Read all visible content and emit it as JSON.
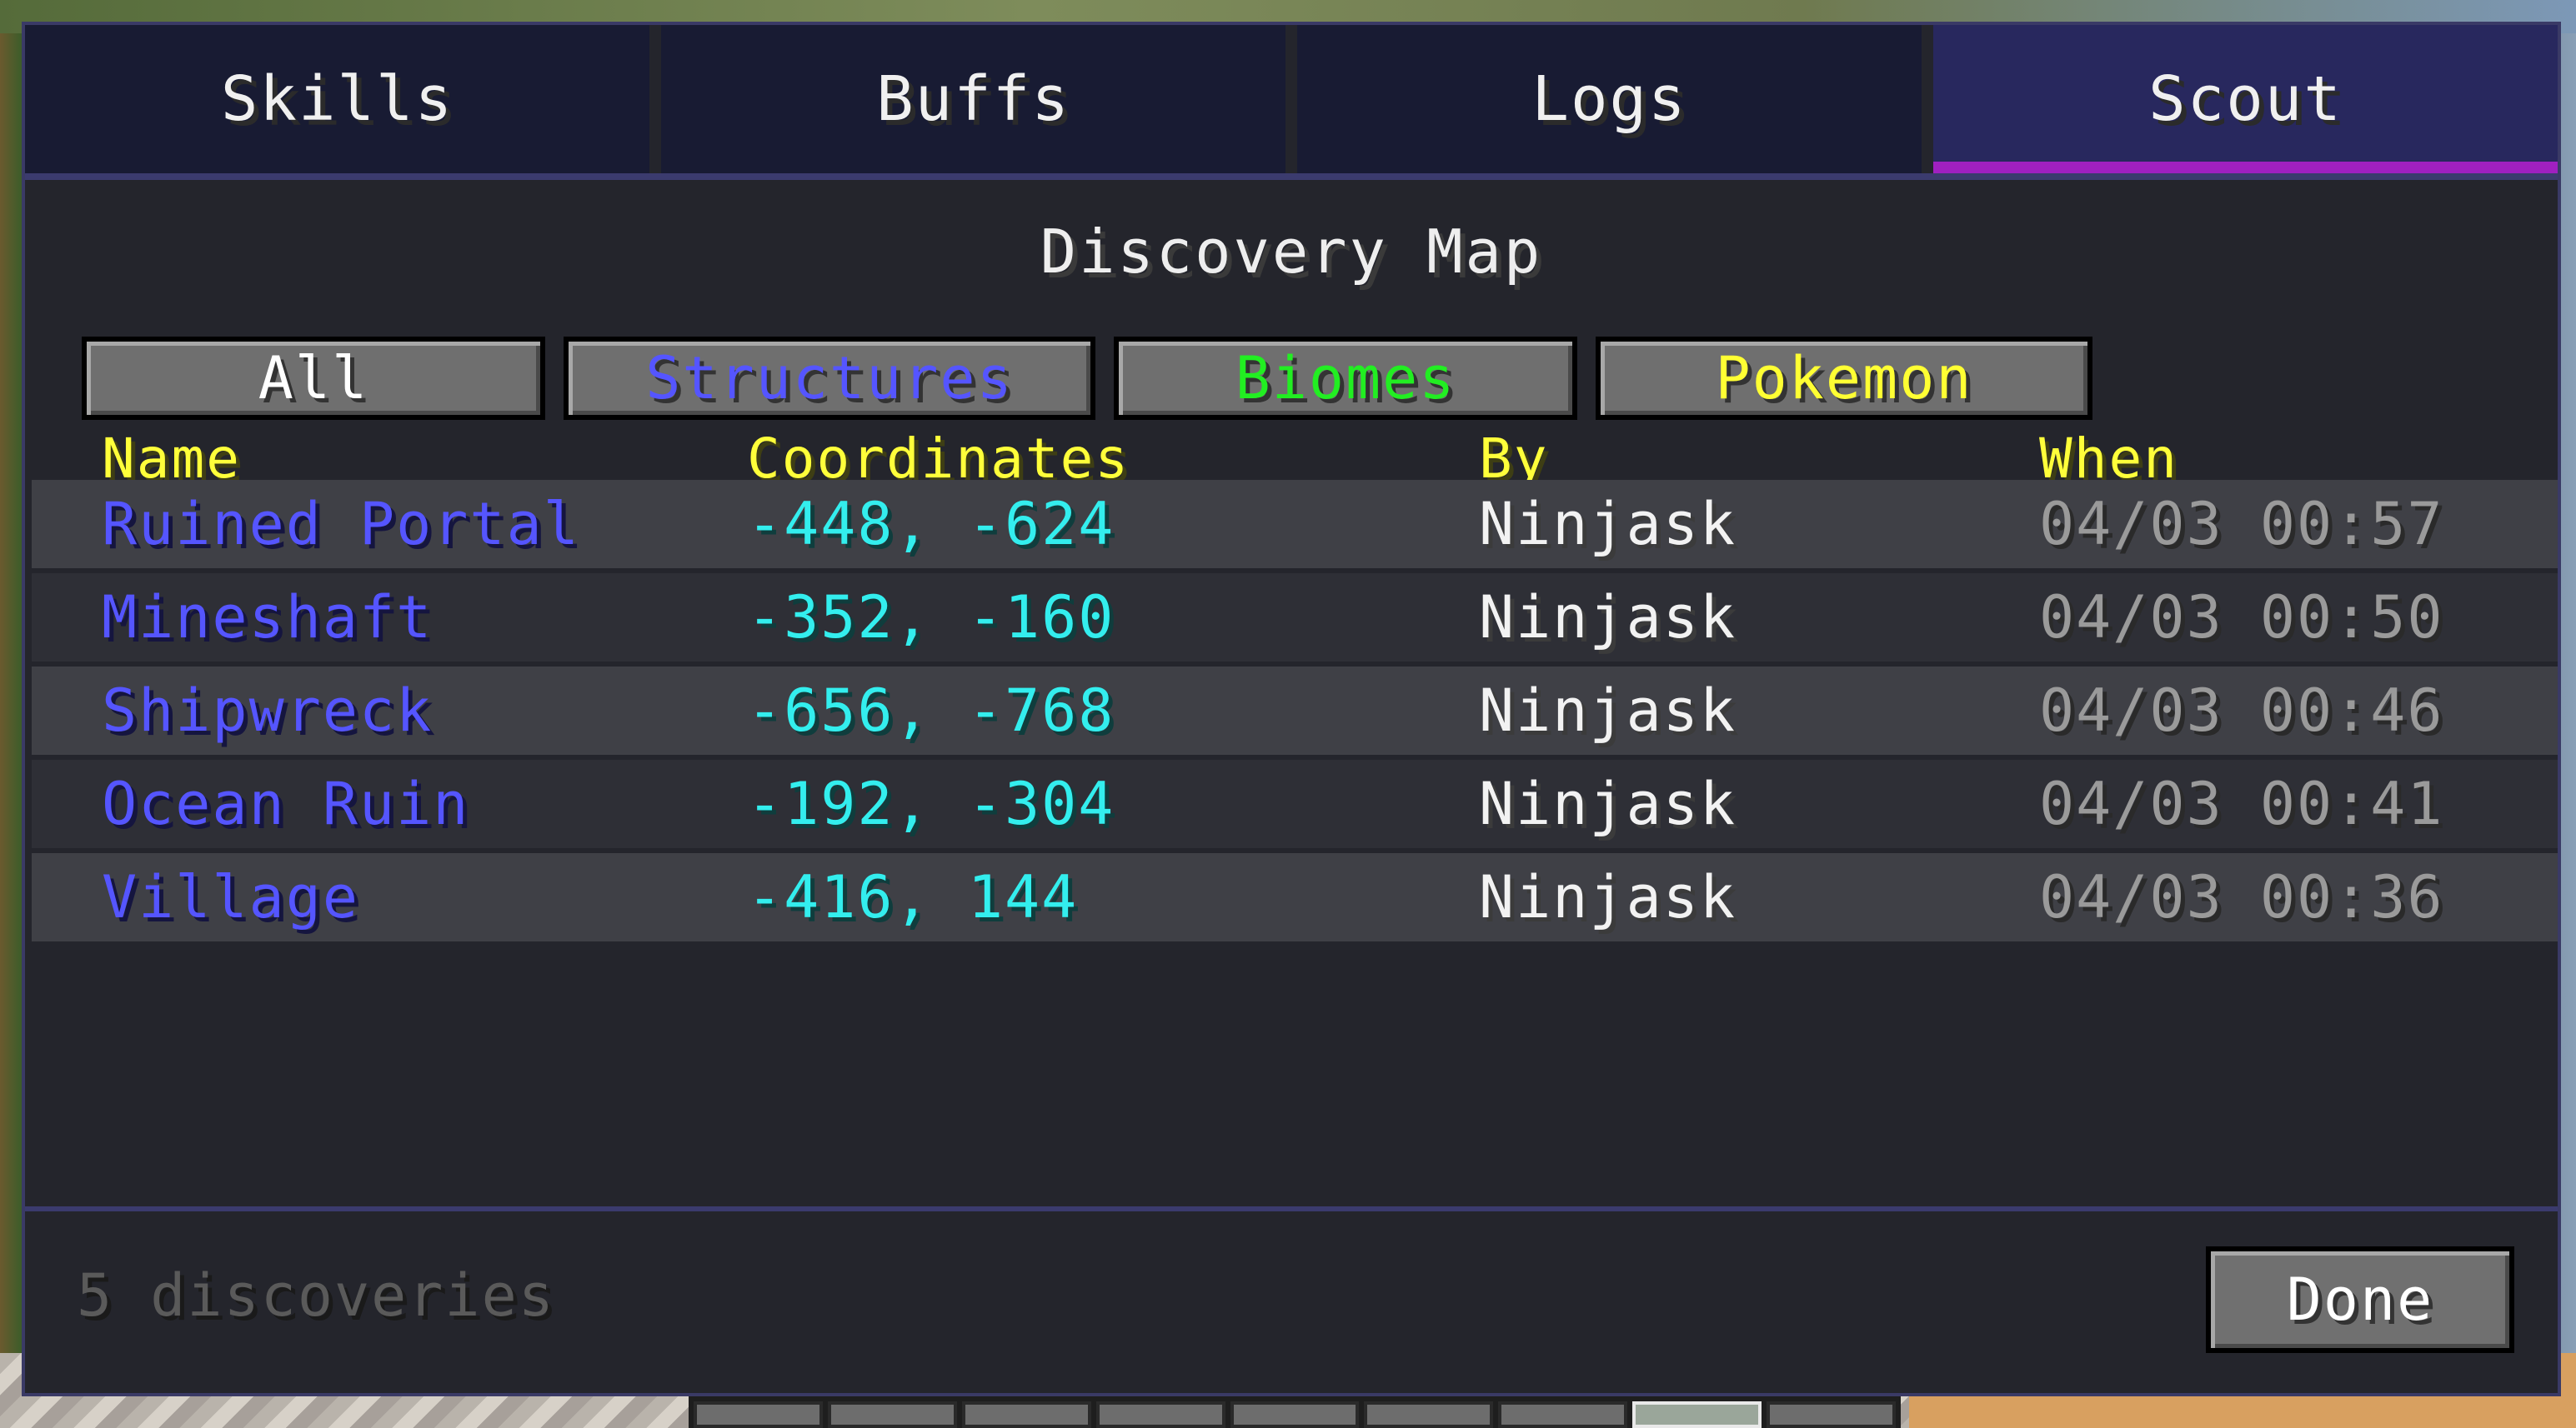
{
  "tabs": [
    {
      "label": "Skills",
      "active": false
    },
    {
      "label": "Buffs",
      "active": false
    },
    {
      "label": "Logs",
      "active": false
    },
    {
      "label": "Scout",
      "active": true
    }
  ],
  "title": "Discovery Map",
  "filters": {
    "all": "All",
    "structures": "Structures",
    "biomes": "Biomes",
    "pokemon": "Pokemon"
  },
  "columns": {
    "name": "Name",
    "coordinates": "Coordinates",
    "by": "By",
    "when": "When"
  },
  "rows": [
    {
      "name": "Ruined Portal",
      "coords": "-448, -624",
      "by": "Ninjask",
      "when": "04/03 00:57"
    },
    {
      "name": "Mineshaft",
      "coords": "-352, -160",
      "by": "Ninjask",
      "when": "04/03 00:50"
    },
    {
      "name": "Shipwreck",
      "coords": "-656, -768",
      "by": "Ninjask",
      "when": "04/03 00:46"
    },
    {
      "name": "Ocean Ruin",
      "coords": "-192, -304",
      "by": "Ninjask",
      "when": "04/03 00:41"
    },
    {
      "name": "Village",
      "coords": "-416, 144",
      "by": "Ninjask",
      "when": "04/03 00:36"
    }
  ],
  "footer": {
    "count": "5 discoveries",
    "done": "Done"
  },
  "colors": {
    "accent": "#a020c0",
    "structures": "#5555ff",
    "biomes": "#22ee22",
    "pokemon": "#ffff33",
    "coordinates": "#33eeee",
    "header": "#ffff3a"
  }
}
